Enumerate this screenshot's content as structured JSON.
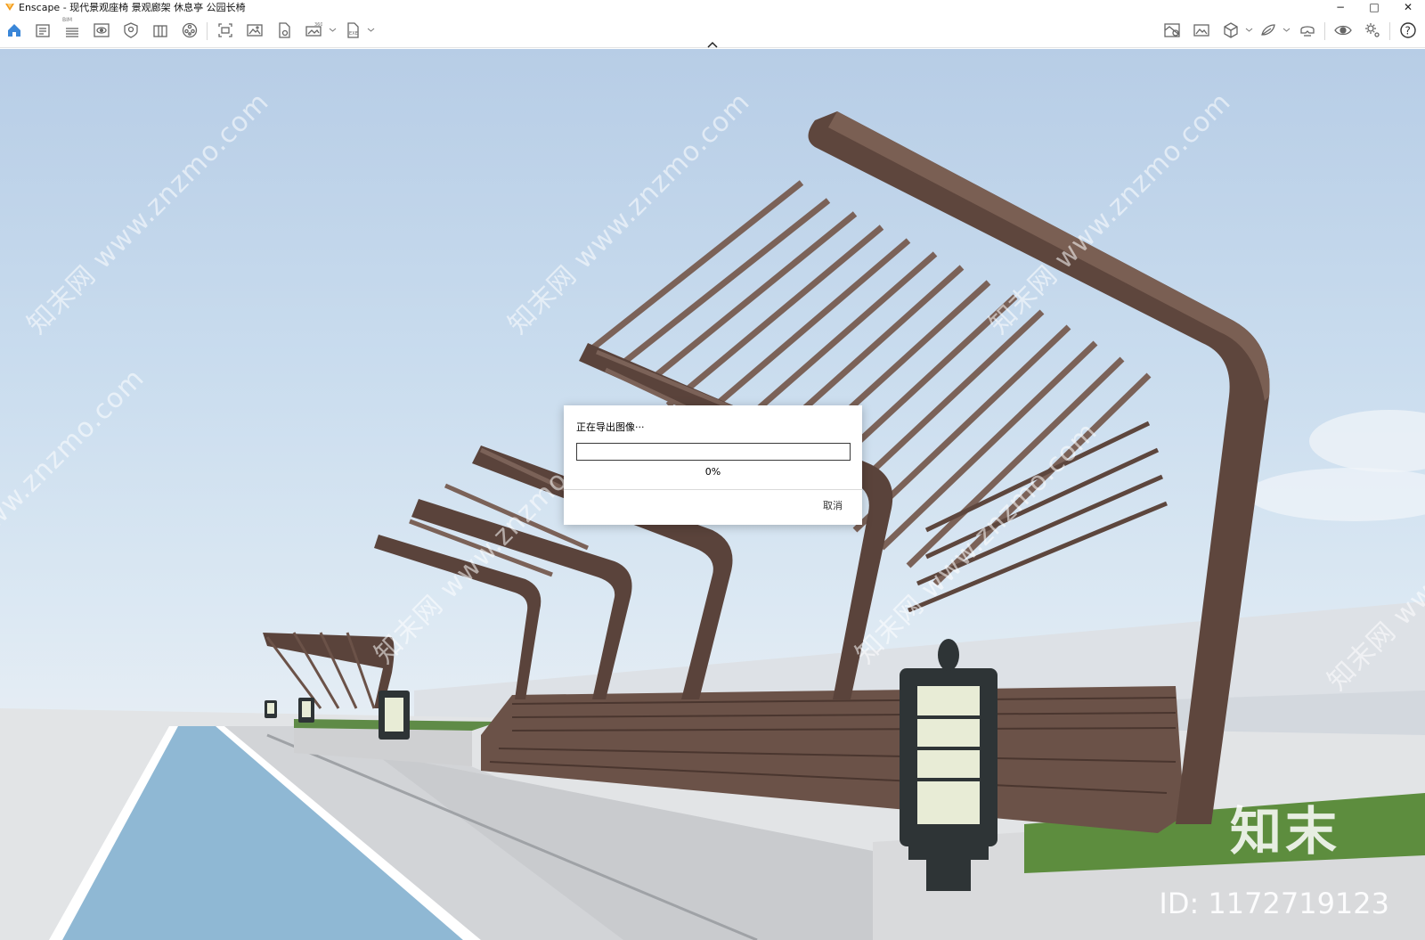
{
  "window": {
    "title": "Enscape - 现代景观座椅 景观廊架 休息亭 公园长椅",
    "minimize_glyph": "−",
    "maximize_glyph": "□",
    "close_glyph": "✕"
  },
  "toolbar": {
    "left_icons": [
      "home-icon",
      "file-manager-icon",
      "bim-icon",
      "visual-settings-icon",
      "atmosphere-icon",
      "scene-icon",
      "asset-library-icon",
      "capture-icon",
      "screenshot-icon",
      "export-document-icon",
      "panorama-360-icon",
      "exe-export-icon"
    ],
    "bim_label": "BIM",
    "right_icons": [
      "view-management-icon",
      "image-gallery-icon",
      "cube-view-icon",
      "material-editor-icon",
      "vr-headset-icon",
      "eye-preview-icon",
      "settings-icon",
      "help-icon"
    ],
    "help_glyph": "?"
  },
  "watermarks": {
    "text": "知末网 www.znzmo.com"
  },
  "brand": {
    "mark": "知末",
    "id": "ID: 1172719123"
  },
  "dialog": {
    "title": "正在导出图像···",
    "progress_text": "0%",
    "progress_value": 0,
    "cancel_label": "取消"
  },
  "colors": {
    "accent": "#3a86d8",
    "sky_top": "#b7cde6",
    "wood": "#6b5248",
    "bike_lane": "#8fb8d4"
  }
}
